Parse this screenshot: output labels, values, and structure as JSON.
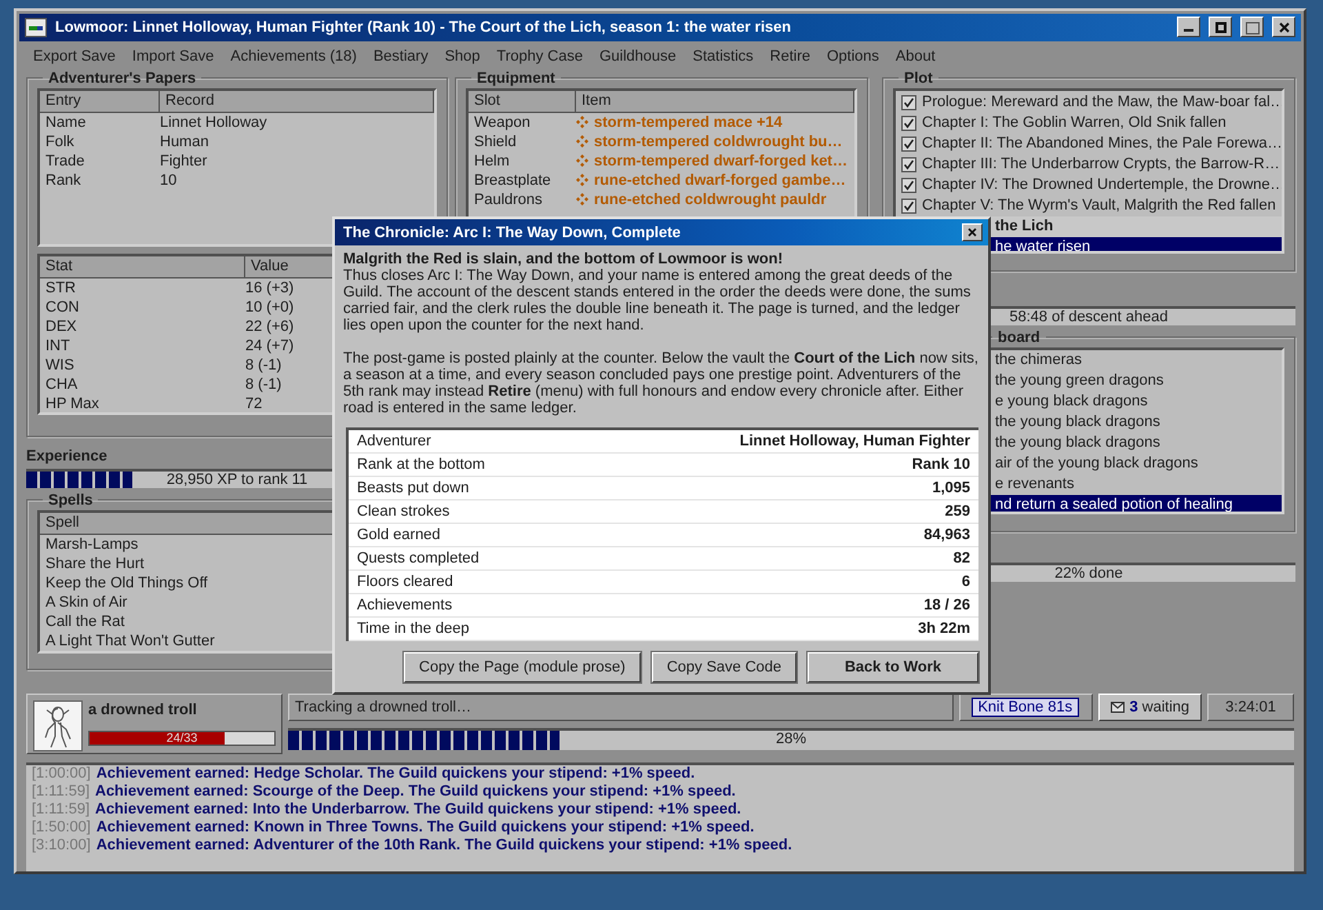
{
  "window": {
    "title": "Lowmoor: Linnet Holloway, Human Fighter (Rank 10) - The Court of the Lich, season 1: the water risen"
  },
  "menu": [
    "Export Save",
    "Import Save",
    "Achievements (18)",
    "Bestiary",
    "Shop",
    "Trophy Case",
    "Guildhouse",
    "Statistics",
    "Retire",
    "Options",
    "About"
  ],
  "papers": {
    "title": "Adventurer's Papers",
    "columns": [
      "Entry",
      "Record"
    ],
    "rows": [
      [
        "Name",
        "Linnet Holloway"
      ],
      [
        "Folk",
        "Human"
      ],
      [
        "Trade",
        "Fighter"
      ],
      [
        "Rank",
        "10"
      ]
    ]
  },
  "stats": {
    "columns": [
      "Stat",
      "Value"
    ],
    "rows": [
      [
        "STR",
        "16 (+3)"
      ],
      [
        "CON",
        "10 (+0)"
      ],
      [
        "DEX",
        "22 (+6)"
      ],
      [
        "INT",
        "24 (+7)"
      ],
      [
        "WIS",
        "8 (-1)"
      ],
      [
        "CHA",
        "8 (-1)"
      ],
      [
        "HP Max",
        "72"
      ]
    ]
  },
  "experience": {
    "label": "Experience",
    "level": 0.25,
    "reading": "28,950 XP to rank 11"
  },
  "spells": {
    "title": "Spells",
    "columns": [
      "Spell"
    ],
    "rows": [
      "Marsh-Lamps",
      "Share the Hurt",
      "Keep the Old Things Off",
      "A Skin of Air",
      "Call the Rat",
      "A Light That Won't Gutter"
    ]
  },
  "equipment": {
    "title": "Equipment",
    "columns": [
      "Slot",
      "Item"
    ],
    "rows": [
      {
        "slot": "Weapon",
        "item": "storm-tempered mace +14"
      },
      {
        "slot": "Shield",
        "item": "storm-tempered coldwrought bu…"
      },
      {
        "slot": "Helm",
        "item": "storm-tempered dwarf-forged ket…"
      },
      {
        "slot": "Breastplate",
        "item": "rune-etched dwarf-forged gambe…"
      },
      {
        "slot": "Pauldrons",
        "item": "rune-etched coldwrought pauldr"
      }
    ]
  },
  "plot": {
    "title": "Plot",
    "items": [
      {
        "kind": "chapter",
        "text": "Prologue: Mereward and the Maw, the Maw-boar fal…",
        "checked": true,
        "selected": false
      },
      {
        "kind": "chapter",
        "text": "Chapter I: The Goblin Warren, Old Snik fallen",
        "checked": true,
        "selected": false
      },
      {
        "kind": "chapter",
        "text": "Chapter II: The Abandoned Mines, the Pale Forewa…",
        "checked": true,
        "selected": false
      },
      {
        "kind": "chapter",
        "text": "Chapter III: The Underbarrow Crypts, the Barrow-R…",
        "checked": true,
        "selected": false
      },
      {
        "kind": "chapter",
        "text": "Chapter IV: The Drowned Undertemple, the Drowne…",
        "checked": true,
        "selected": false
      },
      {
        "kind": "chapter",
        "text": "Chapter V: The Wyrm's Vault, Malgrith the Red fallen",
        "checked": true,
        "selected": false
      },
      {
        "kind": "act",
        "text": "the Lich",
        "selected": false
      },
      {
        "kind": "season",
        "text": "he water risen",
        "selected": true
      }
    ]
  },
  "plot_bar": {
    "reading": "58:48 of descent ahead"
  },
  "quests": {
    "title": "board",
    "items": [
      {
        "text": "the chimeras",
        "selected": false
      },
      {
        "text": "the young green dragons",
        "selected": false
      },
      {
        "text": "e young black dragons",
        "selected": false
      },
      {
        "text": "the young black dragons",
        "selected": false
      },
      {
        "text": "the young black dragons",
        "selected": false
      },
      {
        "text": "air of the young black dragons",
        "selected": false
      },
      {
        "text": "e revenants",
        "selected": false
      },
      {
        "text": "nd return a sealed potion of healing",
        "selected": true
      }
    ]
  },
  "quest_bar": {
    "reading": "22% done"
  },
  "monster": {
    "name": "a drowned troll",
    "hp": {
      "level": 0.73,
      "reading": "24/33"
    }
  },
  "status": "Tracking a drowned troll…",
  "effect": "Knit Bone 81s",
  "messages": "**3** waiting",
  "clock": "3:24:01",
  "progress": {
    "level": 0.27,
    "reading": "28%"
  },
  "log": [
    {
      "time": "[1:00:00]",
      "text": "Achievement earned: Hedge Scholar. The Guild quickens your stipend: +1% speed."
    },
    {
      "time": "[1:11:59]",
      "text": "Achievement earned: Scourge of the Deep. The Guild quickens your stipend: +1% speed."
    },
    {
      "time": "[1:11:59]",
      "text": "Achievement earned: Into the Underbarrow. The Guild quickens your stipend: +1% speed."
    },
    {
      "time": "[1:50:00]",
      "text": "Achievement earned: Known in Three Towns. The Guild quickens your stipend: +1% speed."
    },
    {
      "time": "[3:10:00]",
      "text": "Achievement earned: Adventurer of the 10th Rank. The Guild quickens your stipend: +1% speed."
    }
  ],
  "dialog": {
    "title": "The Chronicle: Arc I: The Way Down, Complete",
    "headline": "Malgrith the Red is slain, and the bottom of Lowmoor is won!",
    "paragraphs": [
      "Thus closes Arc I: The Way Down, and your name is entered among the great deeds of the Guild. The account of the descent stands entered in the order the deeds were done, the sums carried fair, and the clerk rules the double line beneath it. The page is turned, and the ledger lies open upon the counter for the next hand.",
      "The post-game is posted plainly at the counter. Below the vault the **Court of the Lich** now sits, a season at a time, and every season concluded pays one prestige point. Adventurers of the 5th rank may instead **Retire** (menu) with full honours and endow every chronicle after. Either road is entered in the same ledger."
    ],
    "rows": [
      [
        "Adventurer",
        "Linnet Holloway, Human Fighter"
      ],
      [
        "Rank at the bottom",
        "Rank 10"
      ],
      [
        "Beasts put down",
        "1,095"
      ],
      [
        "Clean strokes",
        "259"
      ],
      [
        "Gold earned",
        "84,963"
      ],
      [
        "Quests completed",
        "82"
      ],
      [
        "Floors cleared",
        "6"
      ],
      [
        "Achievements",
        "18 / 26"
      ],
      [
        "Time in the deep",
        "3h 22m"
      ]
    ],
    "buttons": [
      {
        "label": "Copy the Page (module prose)",
        "default": false
      },
      {
        "label": "Copy Save Code",
        "default": false
      },
      {
        "label": "Back to Work",
        "default": true
      }
    ]
  }
}
